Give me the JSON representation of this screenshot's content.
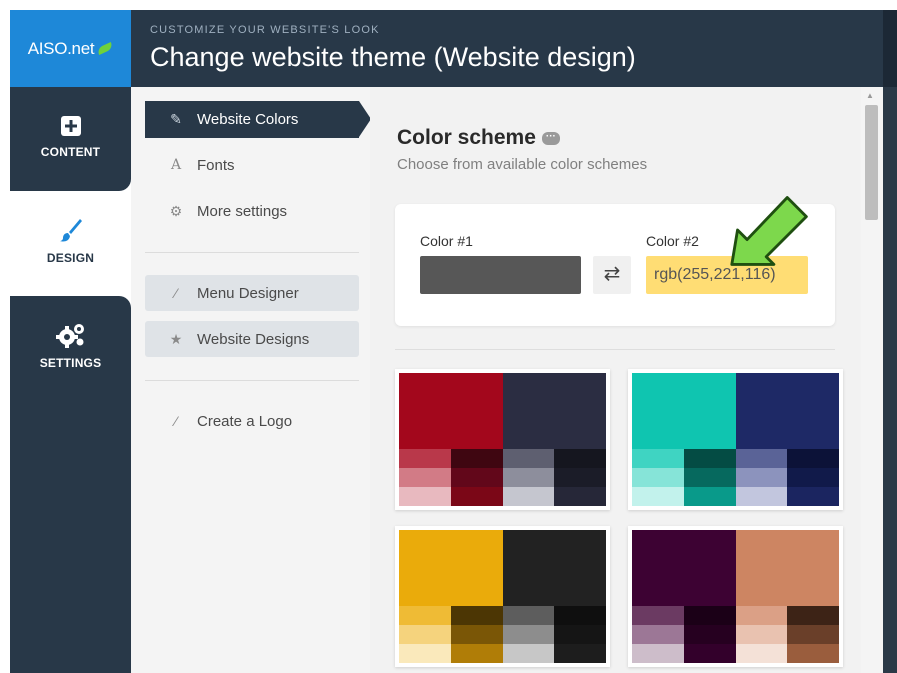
{
  "brand": {
    "logo_text": "AISO.net",
    "accent": "#1e88d8",
    "leaf_color": "#6fd23a"
  },
  "header": {
    "subtitle": "CUSTOMIZE YOUR WEBSITE'S LOOK",
    "title": "Change website theme (Website design)"
  },
  "rail": {
    "items": [
      {
        "label": "CONTENT",
        "icon": "plus-square-icon"
      },
      {
        "label": "DESIGN",
        "icon": "paintbrush-icon"
      },
      {
        "label": "SETTINGS",
        "icon": "gears-icon"
      }
    ]
  },
  "menu": {
    "website_colors": "Website Colors",
    "fonts": "Fonts",
    "more_settings": "More settings",
    "menu_designer": "Menu Designer",
    "website_designs": "Website Designs",
    "create_logo": "Create a Logo"
  },
  "main": {
    "title": "Color scheme",
    "dots": "···",
    "subtitle": "Choose from available color schemes",
    "color1_label": "Color #1",
    "color2_label": "Color #2",
    "color1_value": "",
    "color2_value": "rgb(255,221,116)",
    "swap_icon": "⇄"
  },
  "palettes": [
    {
      "name": "red-navy",
      "main_left": "#a3071c",
      "main_right": "#2b2d42",
      "rows": [
        [
          "#b9384a",
          "#3f0611",
          "#5e5f70",
          "#15161f"
        ],
        [
          "#d27b86",
          "#62071a",
          "#8d8e9c",
          "#1b1c28"
        ],
        [
          "#e8b9bf",
          "#7b0717",
          "#c5c6cf",
          "#262738"
        ]
      ]
    },
    {
      "name": "teal-navy",
      "main_left": "#0fc5b0",
      "main_right": "#1e2966",
      "rows": [
        [
          "#3fd4c2",
          "#044c44",
          "#5a6397",
          "#0c1238"
        ],
        [
          "#86e4d8",
          "#06695e",
          "#8c93bd",
          "#111a4a"
        ],
        [
          "#c2f2ec",
          "#099a8a",
          "#c2c6de",
          "#1b2560"
        ]
      ]
    },
    {
      "name": "gold-black",
      "main_left": "#eaab0b",
      "main_right": "#222222",
      "rows": [
        [
          "#efbb35",
          "#4c3604",
          "#5d5d5d",
          "#0f0f0f"
        ],
        [
          "#f5d37d",
          "#7a5606",
          "#8d8d8d",
          "#151515"
        ],
        [
          "#fae9bb",
          "#b07d07",
          "#c7c7c7",
          "#1d1d1d"
        ]
      ]
    },
    {
      "name": "plum-peach",
      "main_left": "#3d0233",
      "main_right": "#cd8562",
      "rows": [
        [
          "#6b3a62",
          "#1b0017",
          "#dba086",
          "#3d2316"
        ],
        [
          "#9c7796",
          "#260020",
          "#e9c2b0",
          "#6a3f29"
        ],
        [
          "#cdbdca",
          "#33002b",
          "#f4e1d7",
          "#9a5d3d"
        ]
      ]
    }
  ]
}
